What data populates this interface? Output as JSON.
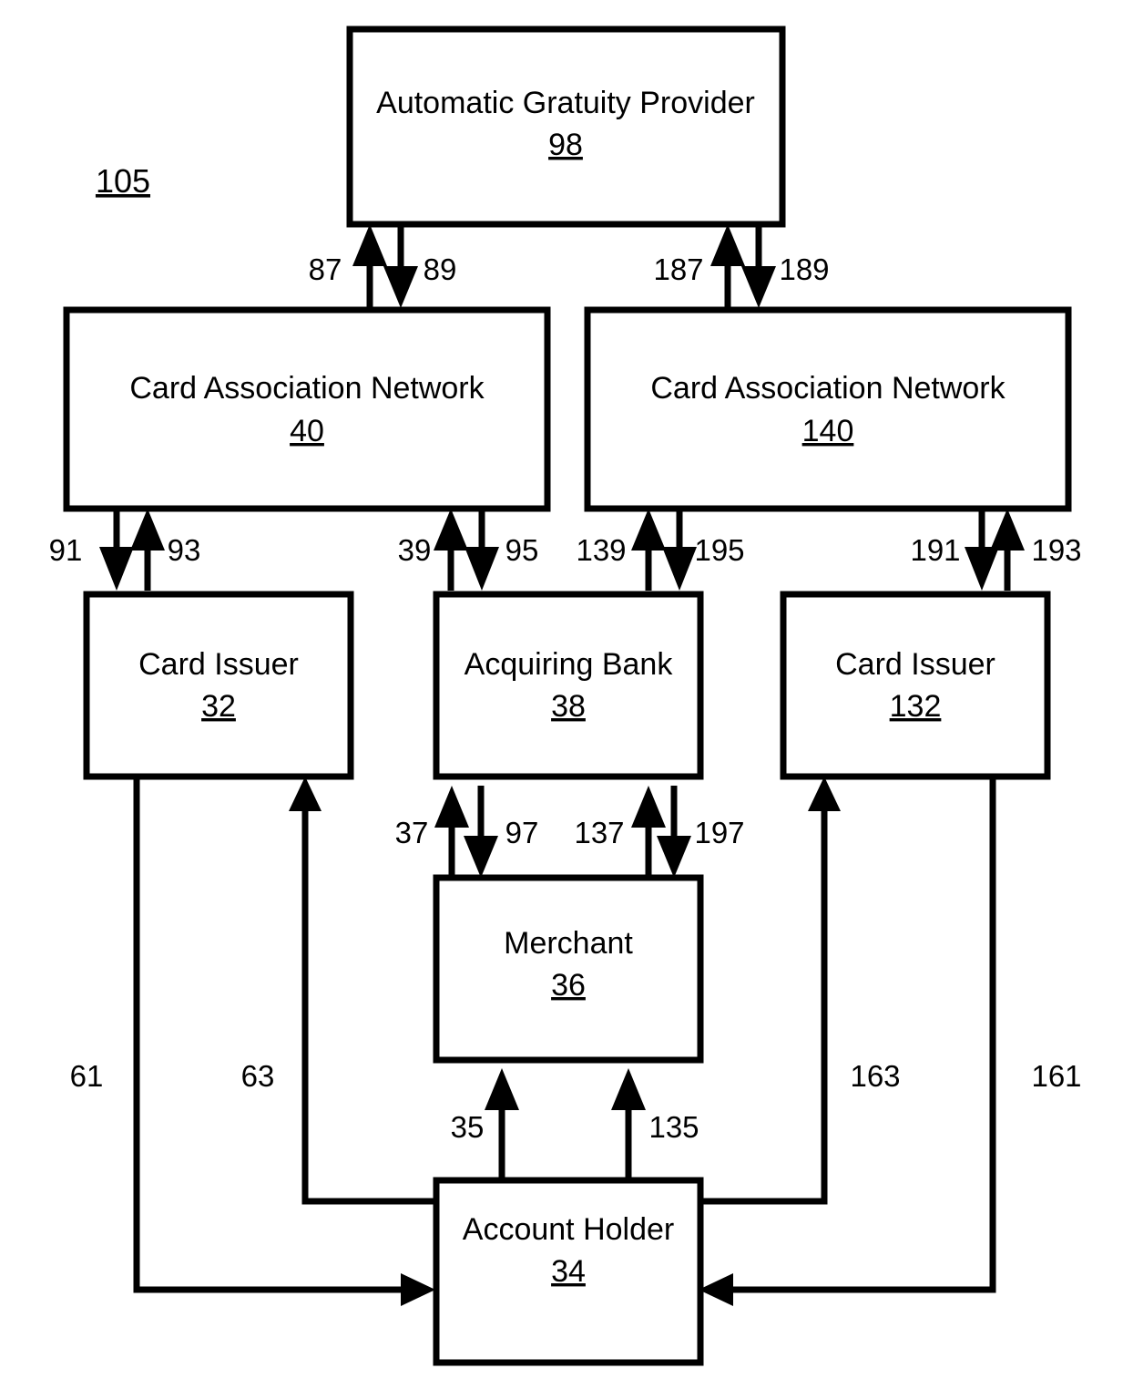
{
  "figure": {
    "ref_label": "105",
    "background_color": "#ffffff",
    "line_color": "#000000"
  },
  "nodes": {
    "gratuity_provider": {
      "title": "Automatic Gratuity Provider",
      "ref": "98"
    },
    "card_association_network_left": {
      "title": "Card Association Network",
      "ref": "40"
    },
    "card_association_network_right": {
      "title": "Card Association Network",
      "ref": "140"
    },
    "card_issuer_left": {
      "title": "Card Issuer",
      "ref": "32"
    },
    "acquiring_bank": {
      "title": "Acquiring Bank",
      "ref": "38"
    },
    "card_issuer_right": {
      "title": "Card Issuer",
      "ref": "132"
    },
    "merchant": {
      "title": "Merchant",
      "ref": "36"
    },
    "account_holder": {
      "title": "Account Holder",
      "ref": "34"
    }
  },
  "edges": {
    "provider_can40_up": "87",
    "provider_can40_down": "89",
    "provider_can140_up": "187",
    "provider_can140_down": "189",
    "can40_issuer32_down": "91",
    "can40_issuer32_up": "93",
    "can40_bank38_up": "39",
    "can40_bank38_down": "95",
    "can140_bank38_up": "139",
    "can140_bank38_down": "195",
    "can140_issuer132_down": "191",
    "can140_issuer132_up": "193",
    "bank38_merchant_up": "37",
    "bank38_merchant_down": "97",
    "bank38_merchant_up2": "137",
    "bank38_merchant_down2": "197",
    "holder_merchant_left": "35",
    "holder_merchant_right": "135",
    "issuer32_holder": "61",
    "holder_issuer32": "63",
    "holder_issuer132": "163",
    "issuer132_holder": "161"
  }
}
